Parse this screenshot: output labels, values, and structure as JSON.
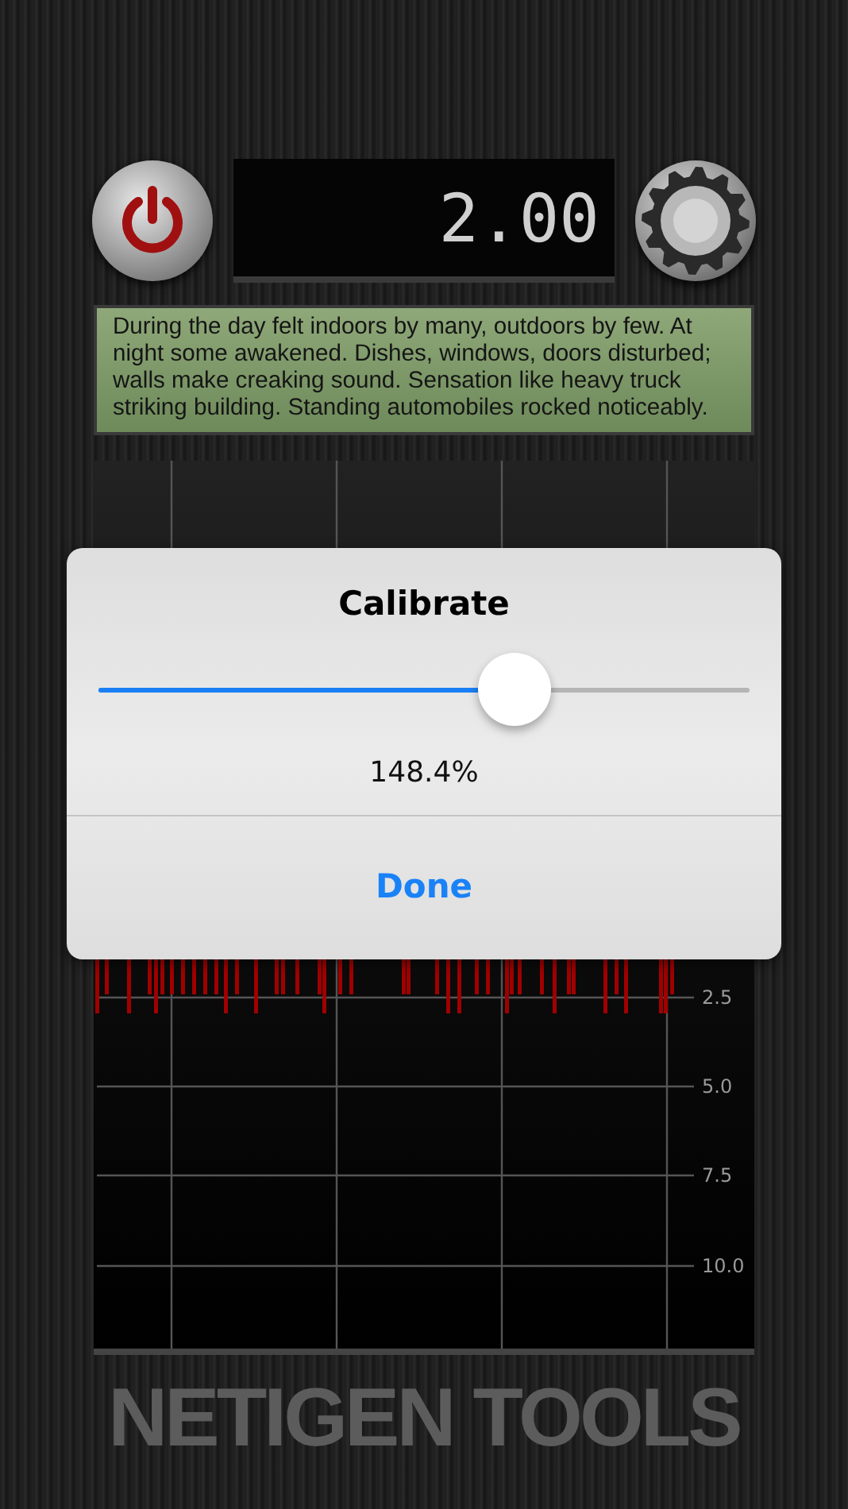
{
  "display": {
    "reading": "2.00"
  },
  "description": "During the day felt indoors by many, outdoors by few. At night some awakened. Dishes, windows, doors disturbed; walls make creaking sound. Sensation like heavy truck striking building. Standing automobiles rocked noticeably.",
  "chart": {
    "scale_labels": [
      "2.5",
      "5.0",
      "7.5",
      "10.0"
    ]
  },
  "brand": "NETIGEN TOOLS",
  "dialog": {
    "title": "Calibrate",
    "slider": {
      "level": 0.64
    },
    "reading": "148.4%",
    "button": "Done"
  }
}
